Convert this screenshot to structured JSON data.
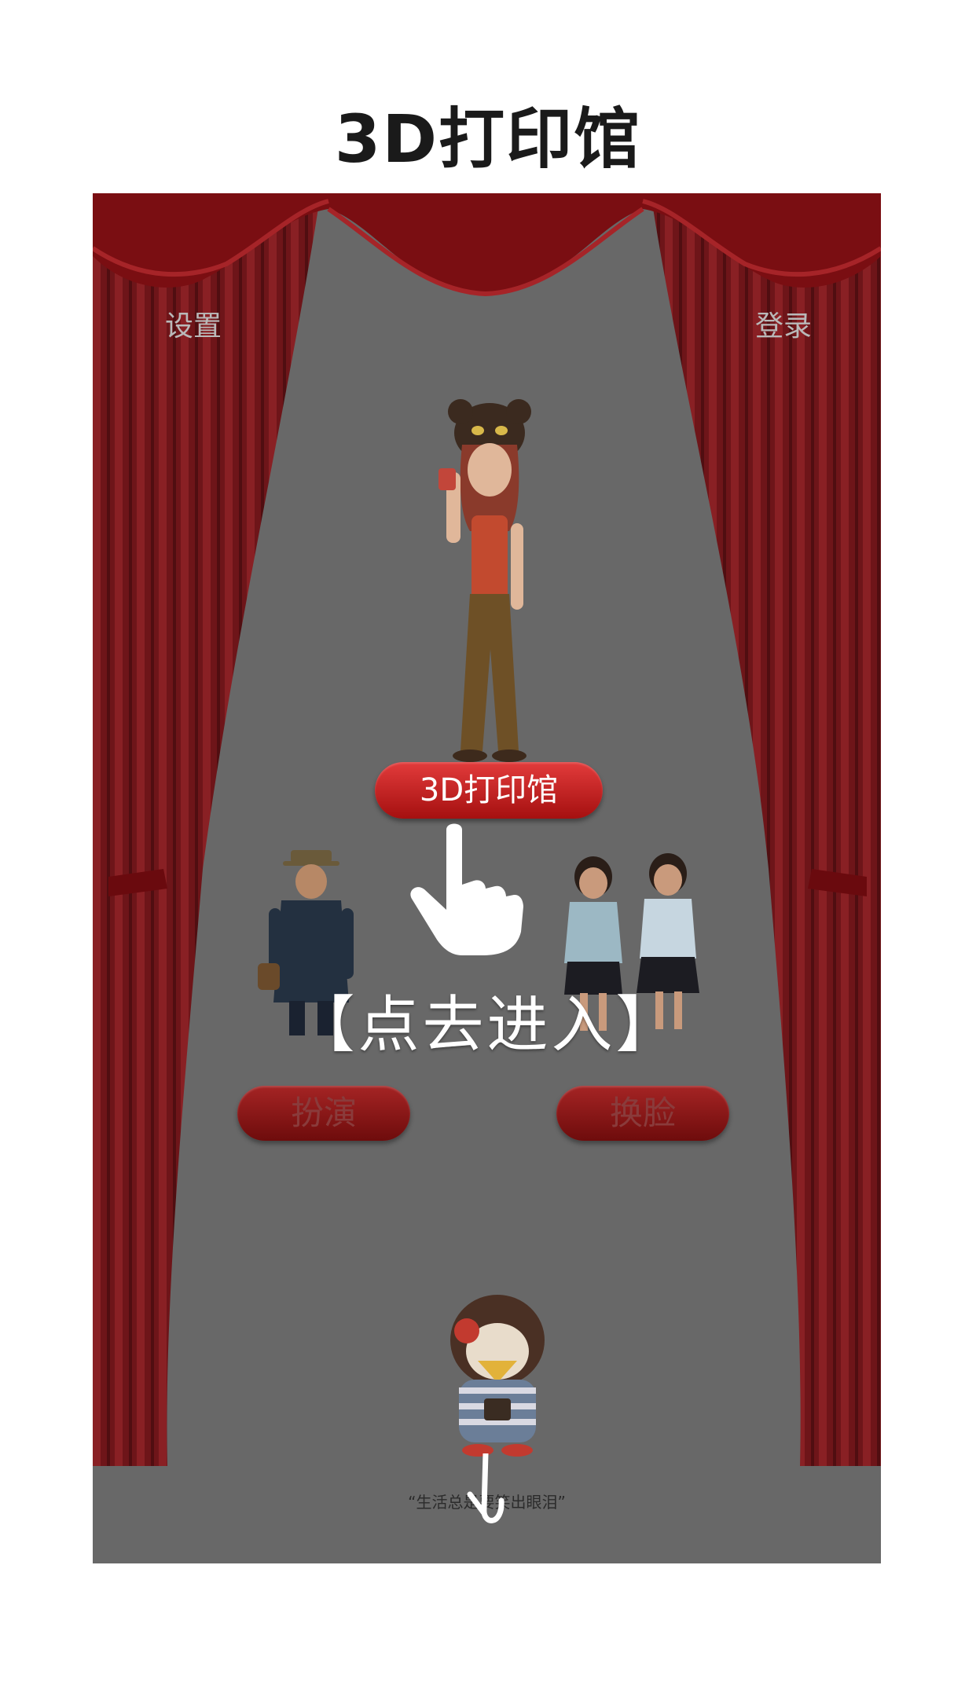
{
  "app": {
    "title": "3D打印馆"
  },
  "header": {
    "settings_label": "设置",
    "login_label": "登录"
  },
  "main": {
    "primary_button_label": "3D打印馆",
    "enter_hint": "【点去进入】",
    "secondary_buttons": [
      {
        "label": "扮演"
      },
      {
        "label": "换脸"
      }
    ],
    "motto": "“生活总是要笑出眼泪”"
  },
  "colors": {
    "curtain": "#7a0e12",
    "stage_overlay": "#686868",
    "button_red": "#c21a1a"
  },
  "icons": [
    "curtain",
    "pointing-hand-icon",
    "scroll-arrow-icon",
    "mascot-penguin"
  ]
}
